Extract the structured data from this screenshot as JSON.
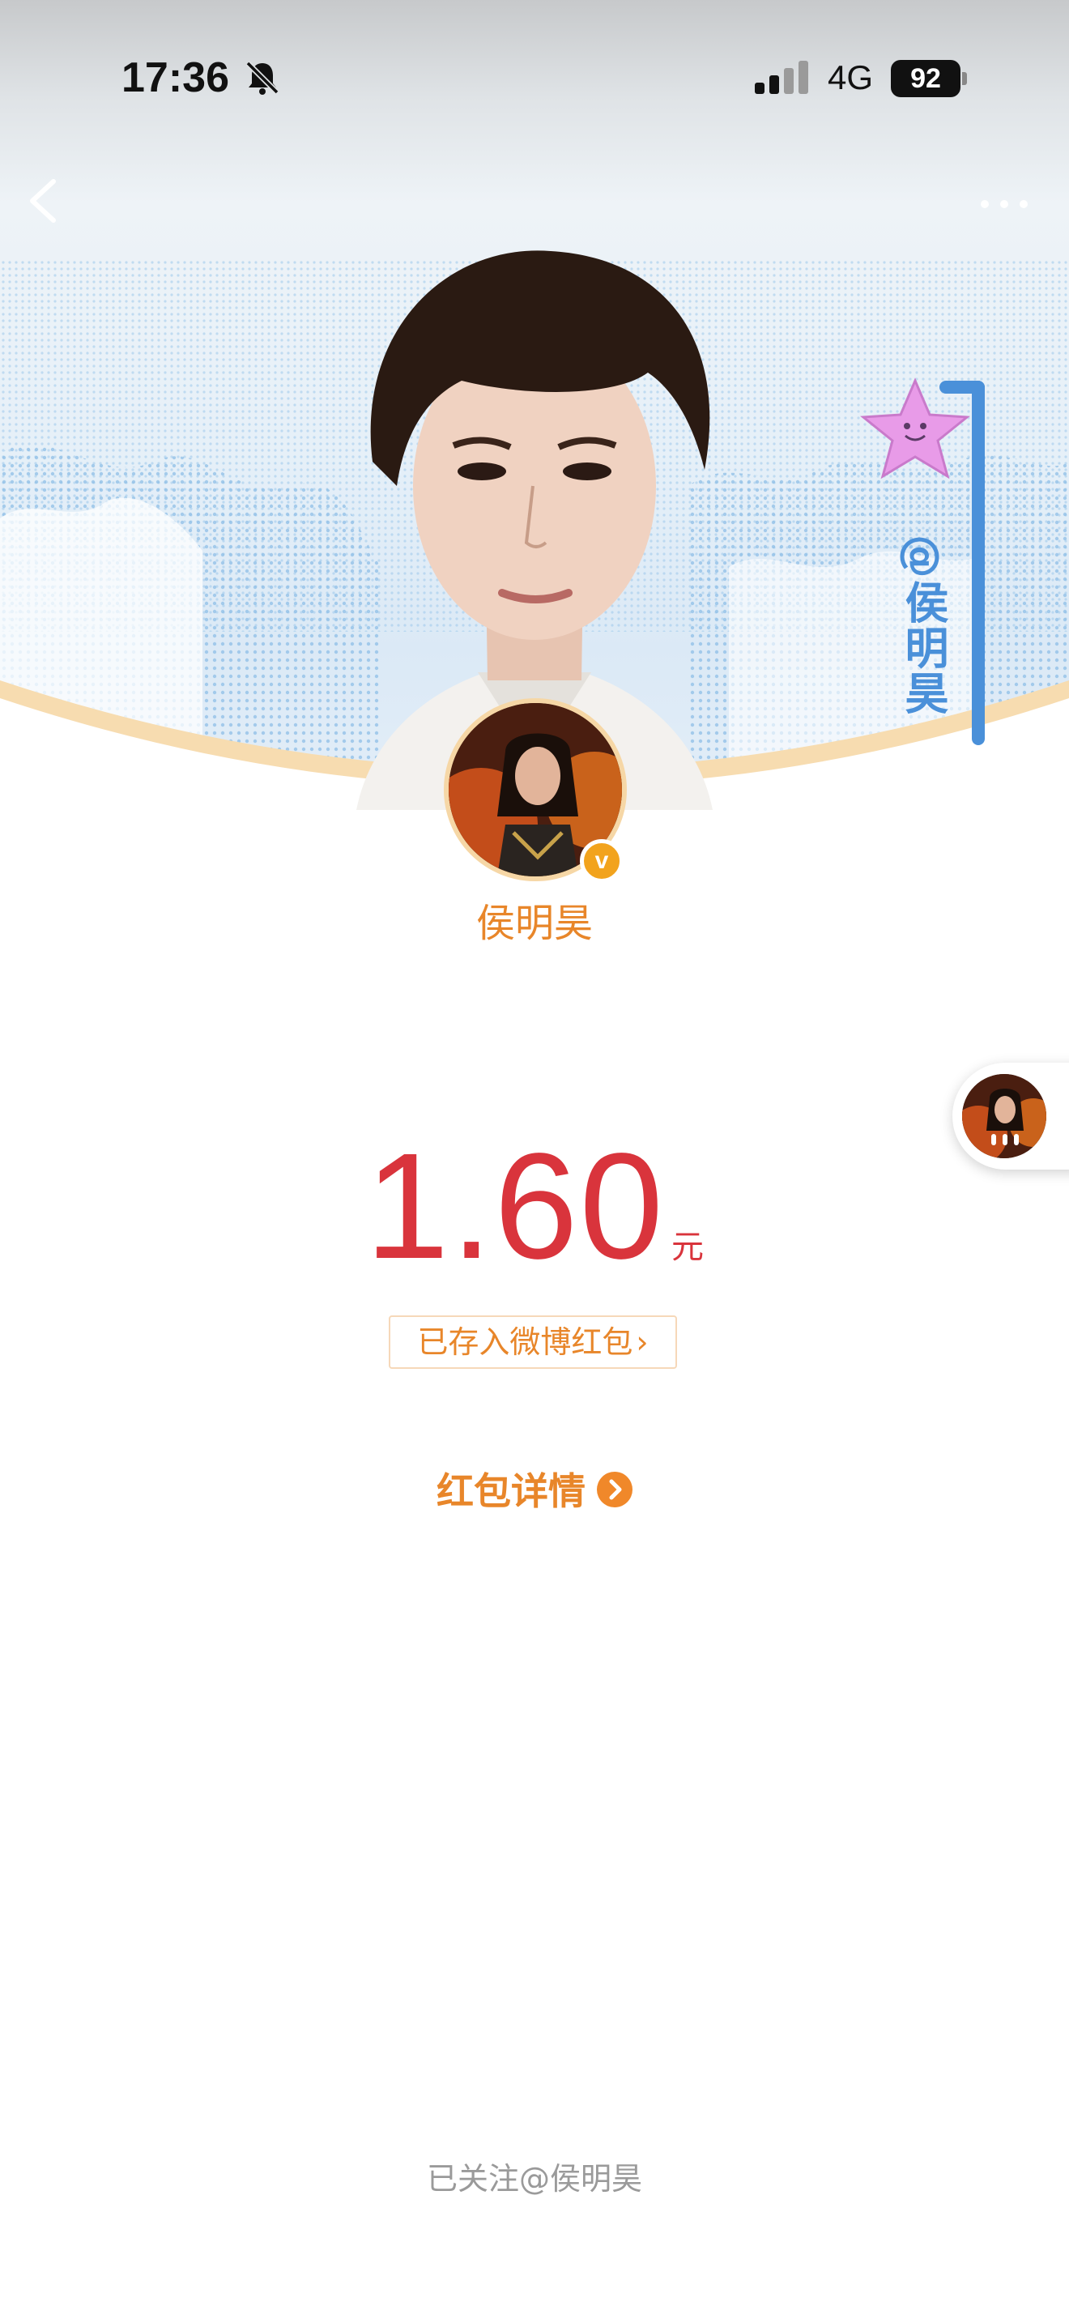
{
  "status_bar": {
    "time": "17:36",
    "network": "4G",
    "battery": "92"
  },
  "icons": {
    "back": "chevron-left-icon",
    "more": "more-dots-icon",
    "mute": "bell-slash-icon",
    "signal": "signal-bars-icon"
  },
  "banner": {
    "tag_text": "@侯明昊"
  },
  "sender": {
    "name": "侯明昊",
    "verified_badge": "v"
  },
  "red_packet": {
    "amount": "1.60",
    "unit": "元",
    "saved_label": "已存入微博红包",
    "saved_chevron": "›",
    "details_label": "红包详情"
  },
  "footer": {
    "followed_text": "已关注@侯明昊"
  },
  "colors": {
    "accent_orange": "#e8862a",
    "amount_red": "#d9343c",
    "tag_blue": "#4a90d9",
    "muted_gray": "#9a9a9a"
  }
}
